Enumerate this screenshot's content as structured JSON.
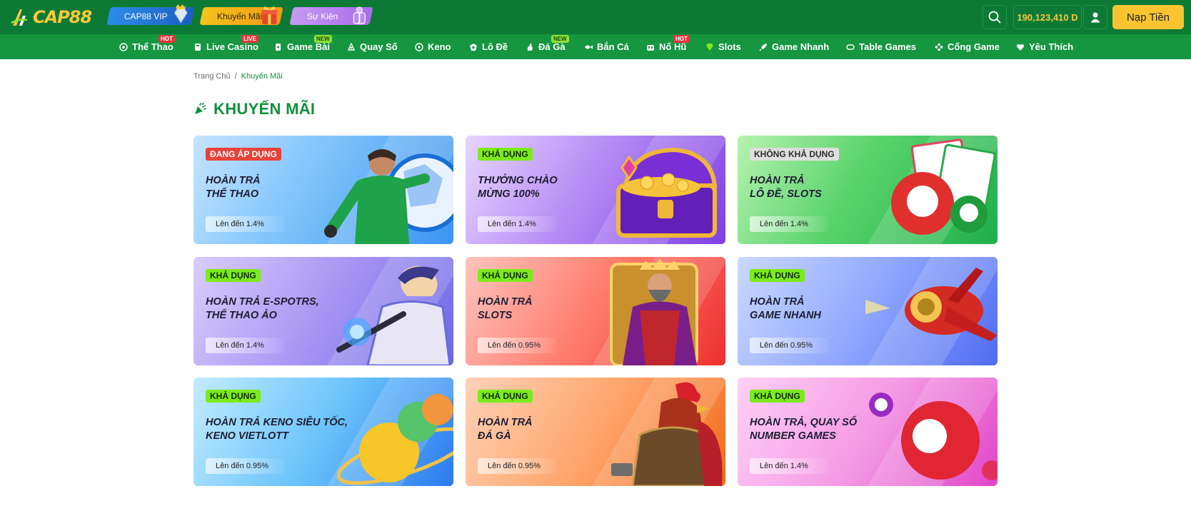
{
  "header": {
    "logo_text": "CAP88",
    "pills": [
      {
        "label": "CAP88 VIP",
        "icon": "diamond-icon"
      },
      {
        "label": "Khuyến Mãi",
        "icon": "gift-icon"
      },
      {
        "label": "Sự Kiện",
        "icon": "gift-box-icon"
      }
    ],
    "balance": "190,123,410 D",
    "deposit_label": "Nạp Tiền"
  },
  "nav": {
    "items": [
      {
        "label": "Thể Thao",
        "badge": "HOT",
        "icon": "soccer-icon"
      },
      {
        "label": "Live Casino",
        "badge": "LIVE",
        "icon": "live-casino-icon"
      },
      {
        "label": "Game Bài",
        "badge": "NEW",
        "icon": "cards-icon"
      },
      {
        "label": "Quay Số",
        "badge": "",
        "icon": "lottery-icon"
      },
      {
        "label": "Keno",
        "badge": "",
        "icon": "keno-icon"
      },
      {
        "label": "Lô Đề",
        "badge": "",
        "icon": "lode-icon"
      },
      {
        "label": "Đá Gà",
        "badge": "NEW",
        "icon": "rooster-icon"
      },
      {
        "label": "Bắn Cá",
        "badge": "",
        "icon": "fish-icon"
      },
      {
        "label": "Nổ Hũ",
        "badge": "HOT",
        "icon": "jackpot-icon"
      },
      {
        "label": "Slots",
        "badge": "",
        "icon": "diamond-icon"
      },
      {
        "label": "Game Nhanh",
        "badge": "",
        "icon": "rocket-icon"
      },
      {
        "label": "Table Games",
        "badge": "",
        "icon": "table-icon"
      },
      {
        "label": "Cổng Game",
        "badge": "",
        "icon": "gamepad-icon"
      },
      {
        "label": "Yêu Thích",
        "badge": "",
        "icon": "heart-icon"
      }
    ]
  },
  "breadcrumb": {
    "home": "Trang Chủ",
    "separator": "/",
    "current": "Khuyến Mãi"
  },
  "page": {
    "title": "KHUYẾN MÃI"
  },
  "promos": [
    {
      "tag": "ĐANG ÁP DỤNG",
      "status": "active",
      "title_lines": [
        "HOÀN TRẢ",
        "THỂ THAO"
      ],
      "up_to": "Lên đến 1.4%",
      "theme": "sky-blue",
      "art": "goalkeeper-icon"
    },
    {
      "tag": "KHẢ DỤNG",
      "status": "avail",
      "title_lines": [
        "THƯỞNG CHÀO",
        "MỪNG 100%"
      ],
      "up_to": "Lên đến 1.4%",
      "theme": "purple",
      "art": "treasure-chest-icon"
    },
    {
      "tag": "KHÔNG KHẢ DỤNG",
      "status": "unavail",
      "title_lines": [
        "HOÀN TRẢ",
        "LÔ ĐỀ, SLOTS"
      ],
      "up_to": "Lên đến 1.4%",
      "theme": "green",
      "art": "bingo-balls-icon"
    },
    {
      "tag": "KHẢ DỤNG",
      "status": "avail",
      "title_lines": [
        "HOÀN TRẢ E-SPOTRS,",
        "THỂ THAO ẢO"
      ],
      "up_to": "Lên đến 1.4%",
      "theme": "lavender",
      "art": "esports-hero-icon"
    },
    {
      "tag": "KHẢ DỤNG",
      "status": "avail",
      "title_lines": [
        "HOÀN TRẢ",
        "SLOTS"
      ],
      "up_to": "Lên đến 0.95%",
      "theme": "red",
      "art": "king-icon"
    },
    {
      "tag": "KHẢ DỤNG",
      "status": "avail",
      "title_lines": [
        "HOÀN TRẢ",
        "GAME NHANH"
      ],
      "up_to": "Lên đến 0.95%",
      "theme": "blue",
      "art": "airplane-icon"
    },
    {
      "tag": "KHẢ DỤNG",
      "status": "avail",
      "title_lines": [
        "HOÀN TRẢ KENO SIÊU TỐC,",
        "KENO VIETLOTT"
      ],
      "up_to": "Lên đến 0.95%",
      "theme": "cyan",
      "art": "keno-balls-icon"
    },
    {
      "tag": "KHẢ DỤNG",
      "status": "avail",
      "title_lines": [
        "HOÀN TRẢ",
        "ĐÁ GÀ"
      ],
      "up_to": "Lên đến 0.95%",
      "theme": "orange",
      "art": "rooster-warrior-icon"
    },
    {
      "tag": "KHẢ DỤNG",
      "status": "avail",
      "title_lines": [
        "HOÀN TRẢ, QUAY SỐ",
        "NUMBER GAMES"
      ],
      "up_to": "Lên đến 1.4%",
      "theme": "pink",
      "art": "lottery-ball-icon"
    }
  ],
  "colors": {
    "header_bg": "#0c7a35",
    "nav_bg": "#16963f",
    "accent_green": "#12913d",
    "deposit_yellow": "#f8c531",
    "balance_text": "#f6c63a"
  }
}
